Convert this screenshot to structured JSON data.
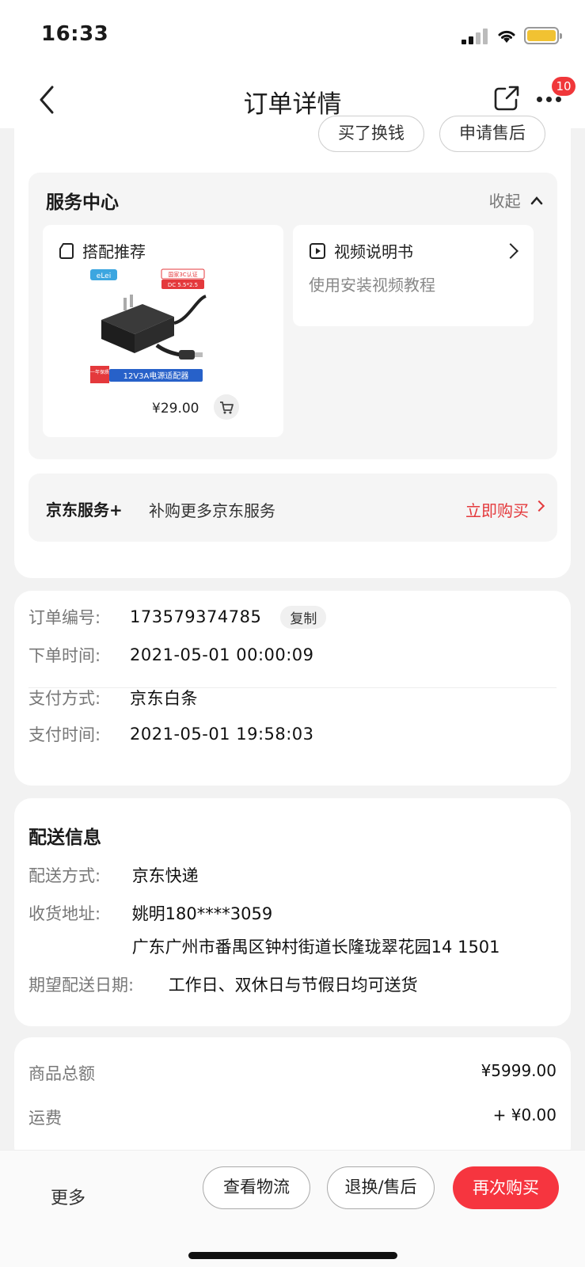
{
  "status_bar": {
    "time": "16:33"
  },
  "header": {
    "title": "订单详情",
    "badge_count": "10"
  },
  "top_actions": {
    "buy_exchange": "买了换钱",
    "after_sale": "申请售后"
  },
  "service_center": {
    "title": "服务中心",
    "collapse_label": "收起",
    "recommend": {
      "label": "搭配推荐",
      "price": "¥29.00",
      "product_text": "12V3A电源适配器",
      "brand": "eLei",
      "cert": "国家3C认证",
      "spec": "DC 5.5*2.5",
      "warranty": "一年保质"
    },
    "video": {
      "label": "视频说明书",
      "subtitle": "使用安装视频教程"
    },
    "jd_service": {
      "name": "京东服务+",
      "desc": "补购更多京东服务",
      "buy_label": "立即购买"
    }
  },
  "order_info": {
    "order_no_label": "订单编号:",
    "order_no": "173579374785",
    "copy_label": "复制",
    "order_time_label": "下单时间:",
    "order_time": "2021-05-01 00:00:09",
    "pay_method_label": "支付方式:",
    "pay_method": "京东白条",
    "pay_time_label": "支付时间:",
    "pay_time": "2021-05-01 19:58:03"
  },
  "delivery": {
    "title": "配送信息",
    "method_label": "配送方式:",
    "method": "京东快递",
    "address_label": "收货地址:",
    "recipient": "姚明180****3059",
    "address": "广东广州市番禺区钟村街道长隆珑翠花园14 1501",
    "date_label": "期望配送日期:",
    "date": "工作日、双休日与节假日均可送货"
  },
  "amount": {
    "goods_label": "商品总额",
    "goods_value": "¥5999.00",
    "shipping_label": "运费",
    "shipping_value": "+ ¥0.00"
  },
  "bottom_bar": {
    "more": "更多",
    "logistics": "查看物流",
    "return": "退换/售后",
    "rebuy": "再次购买"
  },
  "colors": {
    "accent": "#e4393c",
    "rebuy_bg": "#f6353f",
    "page_bg": "#f2f2f2"
  }
}
